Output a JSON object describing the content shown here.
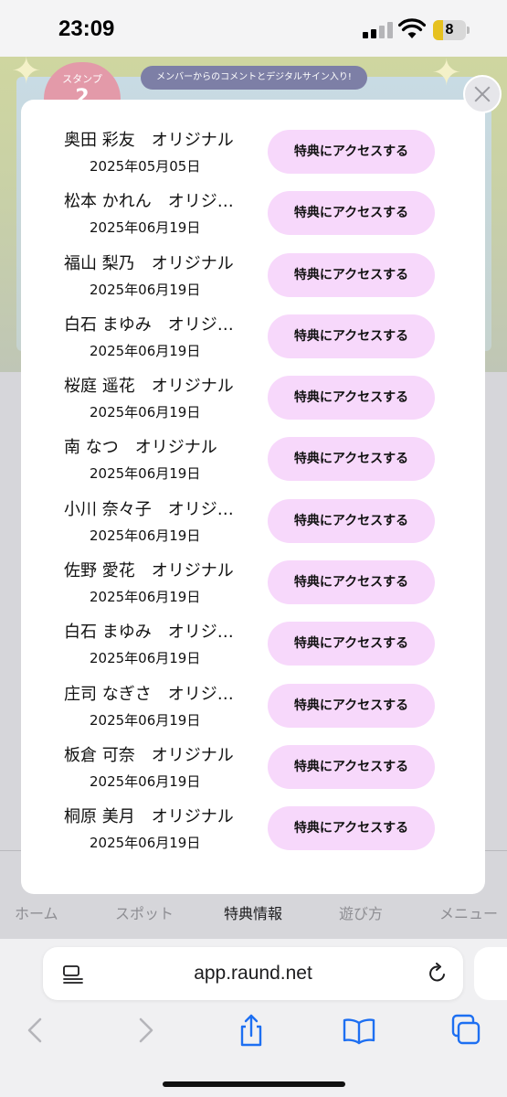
{
  "status_bar": {
    "time": "23:09",
    "battery_level": "8"
  },
  "banner": {
    "stamp_label": "スタンプ",
    "stamp_number": "2",
    "pill_text": "メンバーからのコメントとデジタルサイン入り!"
  },
  "modal": {
    "items": [
      {
        "title": "奥田 彩友　オリジナル",
        "date": "2025年05月05日",
        "button": "特典にアクセスする"
      },
      {
        "title": "松本 かれん　オリジナル",
        "date": "2025年06月19日",
        "button": "特典にアクセスする"
      },
      {
        "title": "福山 梨乃　オリジナル",
        "date": "2025年06月19日",
        "button": "特典にアクセスする"
      },
      {
        "title": "白石 まゆみ　オリジナル",
        "date": "2025年06月19日",
        "button": "特典にアクセスする"
      },
      {
        "title": "桜庭 遥花　オリジナル",
        "date": "2025年06月19日",
        "button": "特典にアクセスする"
      },
      {
        "title": "南 なつ　オリジナル",
        "date": "2025年06月19日",
        "button": "特典にアクセスする"
      },
      {
        "title": "小川 奈々子　オリジナル",
        "date": "2025年06月19日",
        "button": "特典にアクセスする"
      },
      {
        "title": "佐野 愛花　オリジナル",
        "date": "2025年06月19日",
        "button": "特典にアクセスする"
      },
      {
        "title": "白石 まゆみ　オリジナル",
        "date": "2025年06月19日",
        "button": "特典にアクセスする"
      },
      {
        "title": "庄司 なぎさ　オリジナル",
        "date": "2025年06月19日",
        "button": "特典にアクセスする"
      },
      {
        "title": "板倉 可奈　オリジナル",
        "date": "2025年06月19日",
        "button": "特典にアクセスする"
      },
      {
        "title": "桐原 美月　オリジナル",
        "date": "2025年06月19日",
        "button": "特典にアクセスする"
      }
    ]
  },
  "tab_bar": {
    "items": [
      {
        "label": "ホーム"
      },
      {
        "label": "スポット"
      },
      {
        "label": "特典情報"
      },
      {
        "label": "遊び方"
      },
      {
        "label": "メニュー"
      }
    ]
  },
  "browser": {
    "url": "app.raund.net"
  },
  "colors": {
    "button_bg": "#f7d8fb",
    "modal_bg": "#ffffff",
    "overlay": "#d6d6da"
  }
}
